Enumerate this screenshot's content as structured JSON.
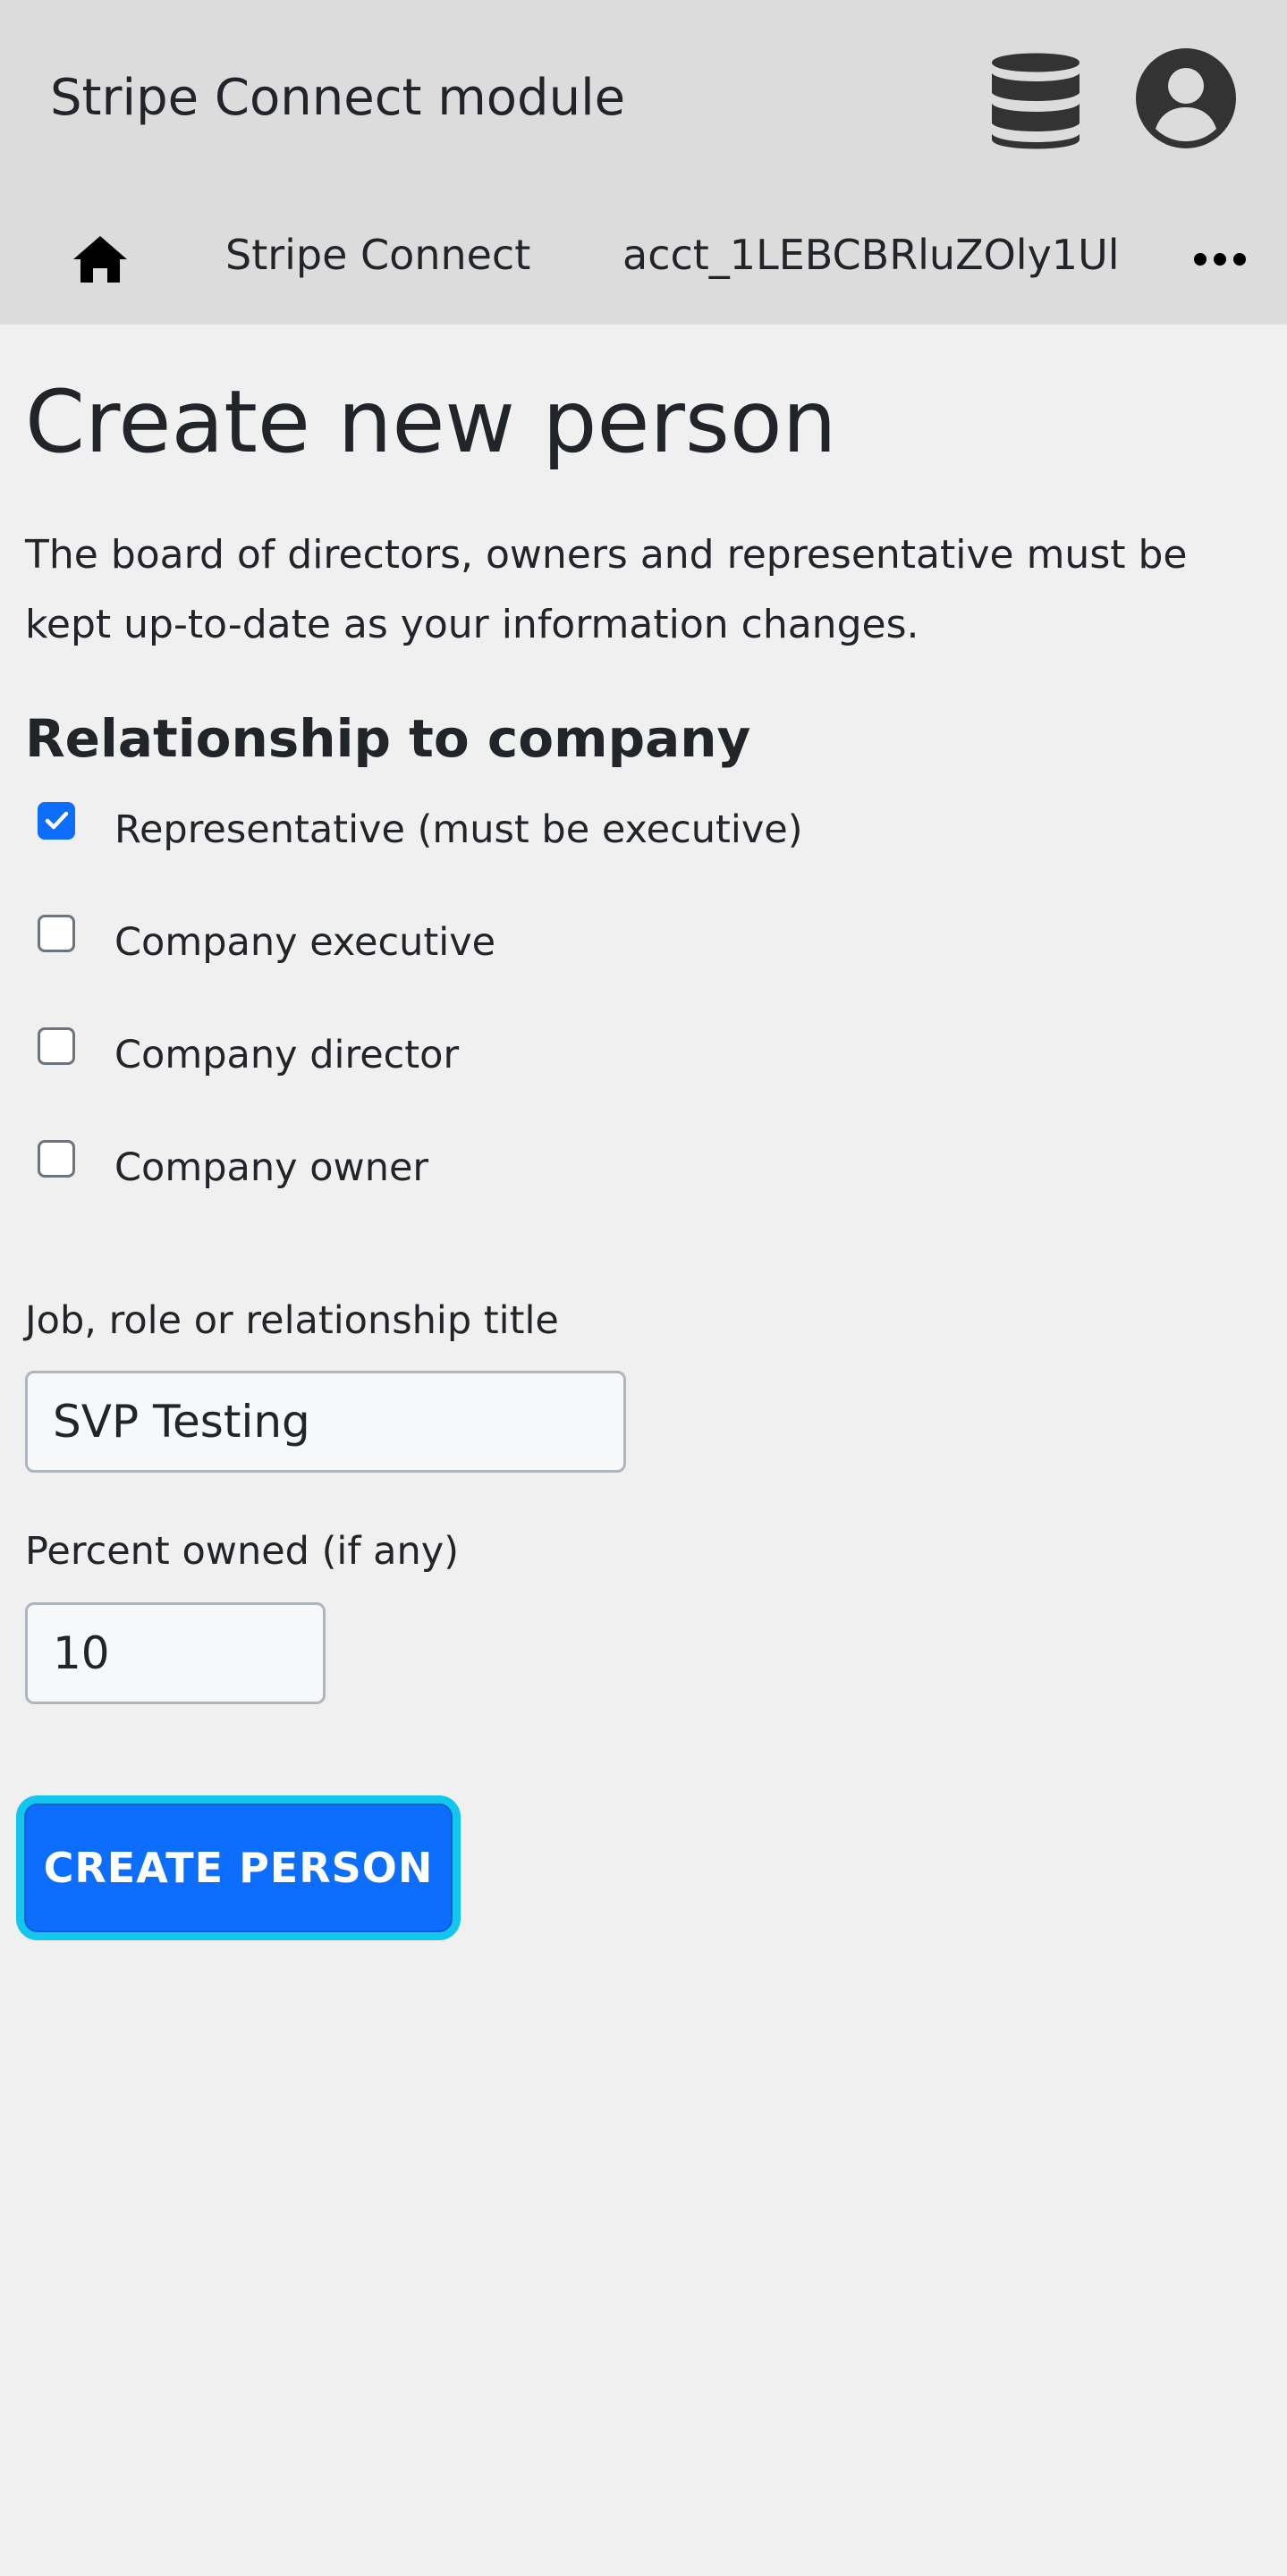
{
  "header": {
    "app_title": "Stripe Connect module",
    "icons": {
      "database": "database-icon",
      "account": "user-circle-icon"
    }
  },
  "breadcrumb": {
    "home_icon": "home-icon",
    "items": [
      {
        "label": "Stripe Connect"
      },
      {
        "label": "acct_1LEBCBRluZOly1Ul"
      }
    ],
    "more_icon": "ellipsis-icon"
  },
  "page": {
    "title": "Create new person",
    "intro": "The board of directors, owners and representative must be kept up-to-date as your information changes."
  },
  "relationship": {
    "heading": "Relationship to company",
    "options": [
      {
        "label": "Representative (must be executive)",
        "checked": true
      },
      {
        "label": "Company executive",
        "checked": false
      },
      {
        "label": "Company director",
        "checked": false
      },
      {
        "label": "Company owner",
        "checked": false
      }
    ]
  },
  "form": {
    "title_label": "Job, role or relationship title",
    "title_value": "SVP Testing",
    "percent_label": "Percent owned (if any)",
    "percent_value": "10",
    "submit_label": "CREATE PERSON"
  },
  "colors": {
    "header_bg": "#dcdcdc",
    "page_bg": "#f0f0f0",
    "accent": "#0d6efd",
    "focus_ring": "#13c6ee"
  }
}
